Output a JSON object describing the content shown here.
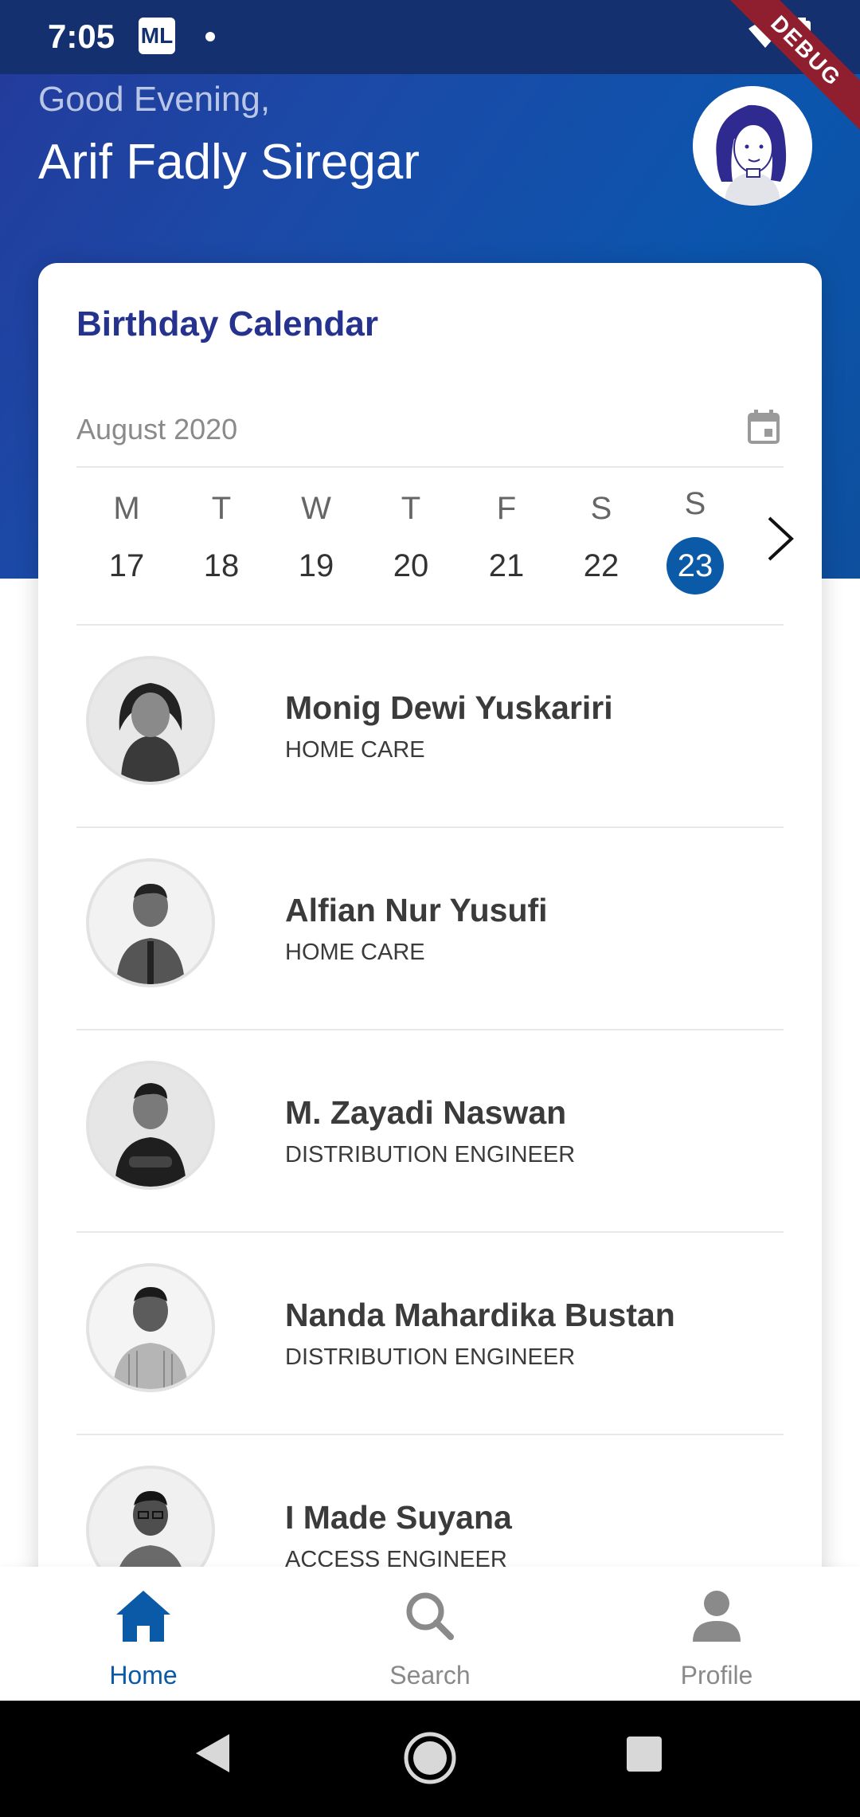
{
  "status_bar": {
    "time": "7:05",
    "app_badge": "ML",
    "debug_label": "DEBUG"
  },
  "header": {
    "greeting": "Good Evening,",
    "user_name": "Arif Fadly Siregar",
    "avatar_icon": "user-avatar-illustration"
  },
  "calendar": {
    "title": "Birthday Calendar",
    "month": "August 2020",
    "month_icon": "calendar-icon",
    "days": [
      {
        "letter": "M",
        "number": "17",
        "selected": false
      },
      {
        "letter": "T",
        "number": "18",
        "selected": false
      },
      {
        "letter": "W",
        "number": "19",
        "selected": false
      },
      {
        "letter": "T",
        "number": "20",
        "selected": false
      },
      {
        "letter": "F",
        "number": "21",
        "selected": false
      },
      {
        "letter": "S",
        "number": "22",
        "selected": false
      },
      {
        "letter": "S",
        "number": "23",
        "selected": true
      }
    ],
    "selected_color": "#0b5aa8"
  },
  "people": [
    {
      "name": "Monig Dewi Yuskariri",
      "role": "HOME CARE"
    },
    {
      "name": "Alfian Nur Yusufi",
      "role": "HOME CARE"
    },
    {
      "name": "M. Zayadi Naswan",
      "role": "DISTRIBUTION ENGINEER"
    },
    {
      "name": "Nanda Mahardika Bustan",
      "role": "DISTRIBUTION ENGINEER"
    },
    {
      "name": "I Made Suyana",
      "role": "ACCESS ENGINEER"
    }
  ],
  "bottom_nav": {
    "items": [
      {
        "label": "Home",
        "icon": "home-icon",
        "active": true
      },
      {
        "label": "Search",
        "icon": "search-icon",
        "active": false
      },
      {
        "label": "Profile",
        "icon": "profile-icon",
        "active": false
      }
    ]
  },
  "colors": {
    "brand_blue": "#0b5aa8",
    "title_blue": "#25338f",
    "header_gradient_start": "#243a9a",
    "header_gradient_end": "#0b55ad"
  }
}
